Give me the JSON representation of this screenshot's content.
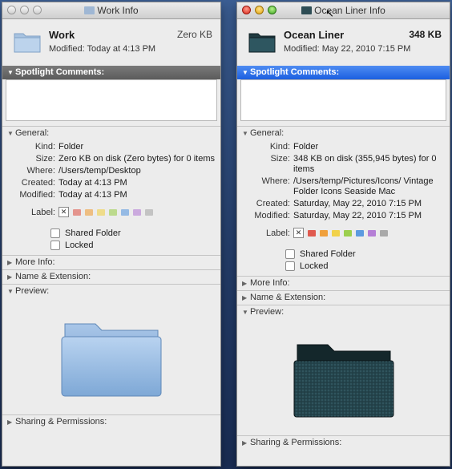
{
  "left": {
    "title": "Work Info",
    "name": "Work",
    "size_short": "Zero KB",
    "modified_line": "Modified: Today at 4:13 PM",
    "spotlight_header": "Spotlight Comments:",
    "general_header": "General:",
    "kind_label": "Kind:",
    "kind": "Folder",
    "size_label": "Size:",
    "size": "Zero KB on disk (Zero bytes) for 0 items",
    "where_label": "Where:",
    "where": "/Users/temp/Desktop",
    "created_label": "Created:",
    "created": "Today at 4:13 PM",
    "modified_label": "Modified:",
    "modified": "Today at 4:13 PM",
    "label_label": "Label:",
    "shared": "Shared Folder",
    "locked": "Locked",
    "more_info": "More Info:",
    "name_ext": "Name & Extension:",
    "preview": "Preview:",
    "sharing": "Sharing & Permissions:"
  },
  "right": {
    "title": "Ocean Liner Info",
    "name": "Ocean Liner",
    "size_short": "348 KB",
    "modified_line": "Modified: May 22, 2010 7:15 PM",
    "spotlight_header": "Spotlight Comments:",
    "general_header": "General:",
    "kind_label": "Kind:",
    "kind": "Folder",
    "size_label": "Size:",
    "size": "348 KB on disk (355,945 bytes) for 0 items",
    "where_label": "Where:",
    "where": "/Users/temp/Pictures/Icons/ Vintage Folder Icons Seaside Mac",
    "created_label": "Created:",
    "created": "Saturday, May 22, 2010 7:15 PM",
    "modified_label": "Modified:",
    "modified": "Saturday, May 22, 2010 7:15 PM",
    "label_label": "Label:",
    "shared": "Shared Folder",
    "locked": "Locked",
    "more_info": "More Info:",
    "name_ext": "Name & Extension:",
    "preview": "Preview:",
    "sharing": "Sharing & Permissions:"
  },
  "label_colors": [
    "#e05a4f",
    "#f0a03c",
    "#f1d24a",
    "#9ccf4f",
    "#5c9ae0",
    "#b57fd6",
    "#a9a9a9"
  ],
  "icons": {
    "x": "✕",
    "cursor": "arrow-cursor-icon",
    "expanded": "▼",
    "collapsed": "▶"
  }
}
